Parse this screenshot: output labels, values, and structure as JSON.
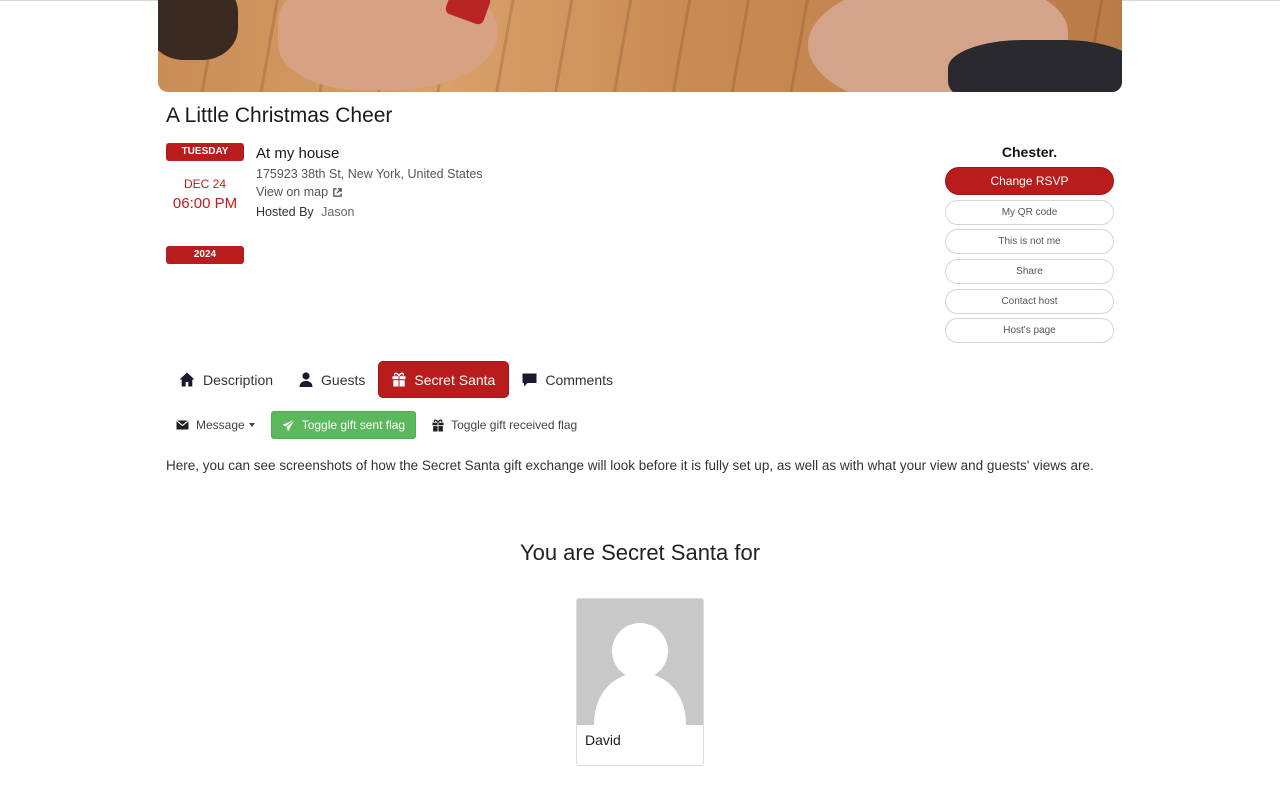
{
  "event": {
    "title": "A Little Christmas Cheer",
    "date": {
      "weekday": "TUESDAY",
      "day": "DEC 24",
      "time": "06:00 PM",
      "year": "2024"
    },
    "venue": {
      "name": "At my house",
      "address": "175923 38th St, New York, United States",
      "map_link": "View on map",
      "hosted_by_label": "Hosted By",
      "host": "Jason"
    }
  },
  "guest_panel": {
    "name": "Chester.",
    "rsvp_button": "Change RSVP",
    "buttons": [
      "My QR code",
      "This is not me",
      "Share",
      "Contact host",
      "Host's page"
    ]
  },
  "tabs": [
    {
      "label": "Description",
      "icon": "home-icon",
      "active": false
    },
    {
      "label": "Guests",
      "icon": "user-icon",
      "active": false
    },
    {
      "label": "Secret Santa",
      "icon": "gift-icon",
      "active": true
    },
    {
      "label": "Comments",
      "icon": "comment-icon",
      "active": false
    }
  ],
  "toolbar": {
    "message": "Message",
    "toggle_sent": "Toggle gift sent flag",
    "toggle_received": "Toggle gift received flag"
  },
  "secret_santa": {
    "description": "Here, you can see screenshots of how the Secret Santa gift exchange will look before it is fully set up, as well as with what your view and guests' views are.",
    "heading": "You are Secret Santa for",
    "recipient": "David"
  },
  "colors": {
    "accent": "#b81c1c",
    "success": "#5cb85c"
  }
}
